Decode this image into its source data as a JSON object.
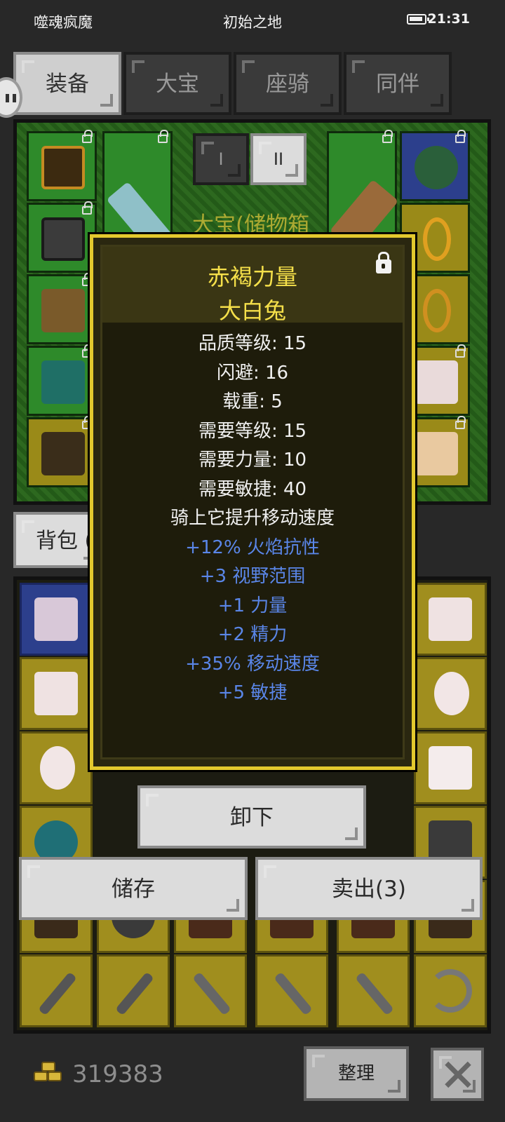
{
  "status": {
    "left_text": "噬魂疯魔",
    "center_text": "初始之地",
    "time": "21:31"
  },
  "tabs": [
    {
      "label": "装备",
      "active": true
    },
    {
      "label": "大宝",
      "active": false
    },
    {
      "label": "座骑",
      "active": false
    },
    {
      "label": "同伴",
      "active": false
    }
  ],
  "equipment": {
    "segments": [
      "I",
      "II"
    ],
    "title": "大宝(储物箱"
  },
  "bag": {
    "tab_label": "背包 ("
  },
  "tooltip": {
    "name": "赤褐力量",
    "subtitle": "大白兔",
    "lines": [
      {
        "text": "品质等级: 15",
        "kind": "base"
      },
      {
        "text": "闪避: 16",
        "kind": "base"
      },
      {
        "text": "载重: 5",
        "kind": "base"
      },
      {
        "text": "需要等级: 15",
        "kind": "base"
      },
      {
        "text": "需要力量: 10",
        "kind": "base"
      },
      {
        "text": "需要敏捷: 40",
        "kind": "base"
      },
      {
        "text": "骑上它提升移动速度",
        "kind": "base"
      },
      {
        "text": "+12% 火焰抗性",
        "kind": "magic"
      },
      {
        "text": "+3 视野范围",
        "kind": "magic"
      },
      {
        "text": "+1 力量",
        "kind": "magic"
      },
      {
        "text": "+2 精力",
        "kind": "magic"
      },
      {
        "text": "+35% 移动速度",
        "kind": "magic"
      },
      {
        "text": "+5 敏捷",
        "kind": "magic"
      }
    ]
  },
  "actions": {
    "unequip": "卸下",
    "store": "储存",
    "sell": "卖出(3)"
  },
  "footer": {
    "gold": "319383",
    "sort_label": "整理"
  },
  "colors": {
    "tooltip_border": "#e3c92e",
    "title": "#f5e04a",
    "magic": "#5a86e8"
  }
}
